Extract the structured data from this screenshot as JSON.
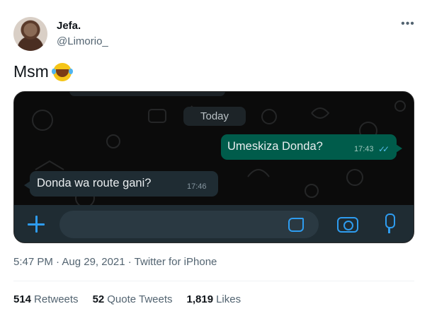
{
  "author": {
    "display_name": "Jefa.",
    "handle": "@Limorio_"
  },
  "more_icon": "more-horizontal-icon",
  "tweet": {
    "text": "Msm",
    "emoji": "face-with-tears-of-joy"
  },
  "chat": {
    "date_divider": "Today",
    "messages": [
      {
        "direction": "outgoing",
        "text": "Umeskiza Donda?",
        "time": "17:43",
        "status": "read"
      },
      {
        "direction": "incoming",
        "text": "Donda wa route gani?",
        "time": "17:46"
      }
    ],
    "icons": [
      "plus-icon",
      "sticker-icon",
      "camera-icon",
      "microphone-icon"
    ],
    "accent_color": "#2e9cef",
    "outgoing_bubble_color": "#005c4b",
    "incoming_bubble_color": "#1f2c33"
  },
  "meta": {
    "timestamp": "5:47 PM · Aug 29, 2021 · Twitter for iPhone"
  },
  "stats": {
    "retweets": {
      "count": "514",
      "label": "Retweets"
    },
    "quote_tweets": {
      "count": "52",
      "label": "Quote Tweets"
    },
    "likes": {
      "count": "1,819",
      "label": "Likes"
    }
  }
}
